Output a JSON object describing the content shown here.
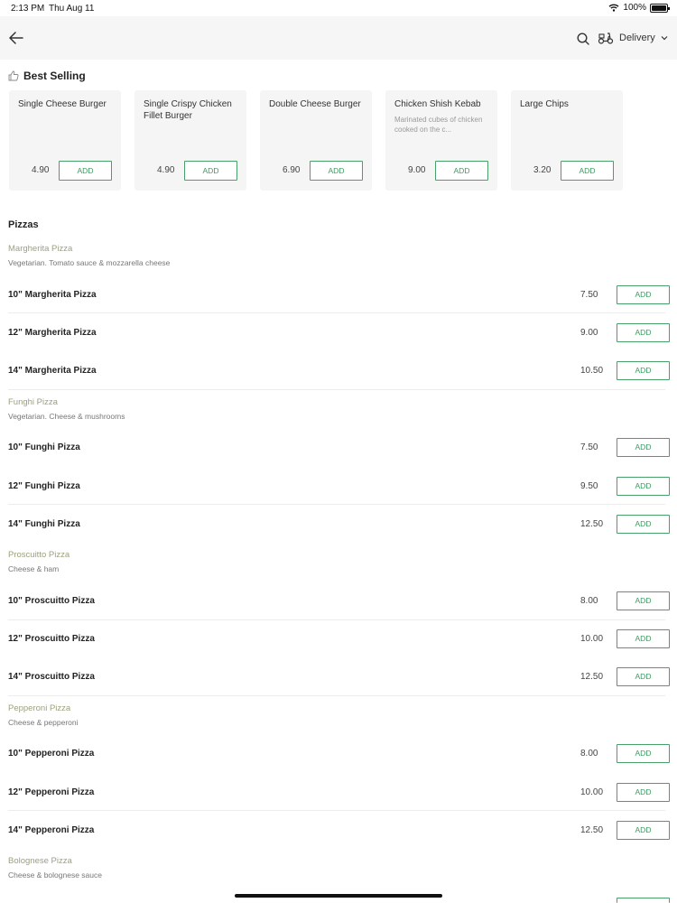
{
  "status_bar": {
    "time": "2:13 PM",
    "date": "Thu Aug 11",
    "battery": "100%"
  },
  "header": {
    "delivery_label": "Delivery"
  },
  "best_selling": {
    "title": "Best Selling",
    "items": [
      {
        "name": "Single Cheese Burger",
        "desc": "",
        "price": "4.90",
        "add": "ADD"
      },
      {
        "name": "Single Crispy Chicken Fillet Burger",
        "desc": "",
        "price": "4.90",
        "add": "ADD"
      },
      {
        "name": "Double Cheese Burger",
        "desc": "",
        "price": "6.90",
        "add": "ADD"
      },
      {
        "name": "Chicken Shish Kebab",
        "desc": "Marinated cubes of chicken cooked on the c...",
        "price": "9.00",
        "add": "ADD"
      },
      {
        "name": "Large Chips",
        "desc": "",
        "price": "3.20",
        "add": "ADD"
      }
    ]
  },
  "pizzas": {
    "title": "Pizzas",
    "groups": [
      {
        "title": "Margherita Pizza",
        "desc": "Vegetarian. Tomato sauce & mozzarella cheese",
        "items": [
          {
            "name": "10\" Margherita Pizza",
            "price": "7.50",
            "add": "ADD"
          },
          {
            "name": "12\" Margherita Pizza",
            "price": "9.00",
            "add": "ADD"
          },
          {
            "name": "14\" Margherita Pizza",
            "price": "10.50",
            "add": "ADD"
          }
        ]
      },
      {
        "title": "Funghi Pizza",
        "desc": "Vegetarian. Cheese & mushrooms",
        "items": [
          {
            "name": "10\" Funghi Pizza",
            "price": "7.50",
            "add": "ADD"
          },
          {
            "name": "12\" Funghi Pizza",
            "price": "9.50",
            "add": "ADD"
          },
          {
            "name": "14\" Funghi Pizza",
            "price": "12.50",
            "add": "ADD"
          }
        ]
      },
      {
        "title": "Proscuitto Pizza",
        "desc": "Cheese & ham",
        "items": [
          {
            "name": "10\" Proscuitto Pizza",
            "price": "8.00",
            "add": "ADD"
          },
          {
            "name": "12\" Proscuitto Pizza",
            "price": "10.00",
            "add": "ADD"
          },
          {
            "name": "14\" Proscuitto Pizza",
            "price": "12.50",
            "add": "ADD"
          }
        ]
      },
      {
        "title": "Pepperoni Pizza",
        "desc": "Cheese & pepperoni",
        "items": [
          {
            "name": "10\" Pepperoni Pizza",
            "price": "8.00",
            "add": "ADD"
          },
          {
            "name": "12\" Pepperoni Pizza",
            "price": "10.00",
            "add": "ADD"
          },
          {
            "name": "14\" Pepperoni Pizza",
            "price": "12.50",
            "add": "ADD"
          }
        ]
      },
      {
        "title": "Bolognese Pizza",
        "desc": "Cheese & bolognese sauce",
        "items": []
      }
    ]
  }
}
